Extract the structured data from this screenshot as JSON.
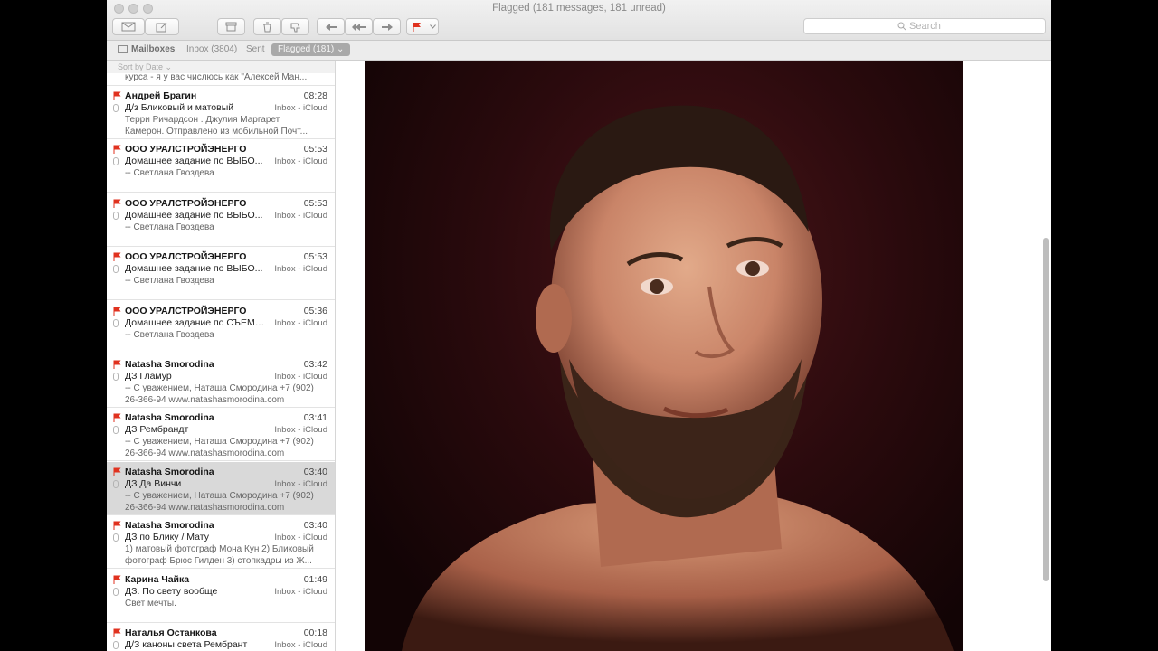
{
  "window": {
    "title": "Flagged (181 messages, 181 unread)"
  },
  "toolbar": {
    "search_placeholder": "Search"
  },
  "favorites": {
    "mailboxes": "Mailboxes",
    "inbox": "Inbox (3804)",
    "sent": "Sent",
    "flagged": "Flagged (181) ⌄"
  },
  "sort": {
    "label": "Sort by Date ⌄"
  },
  "list": {
    "partial_preview": "курса - я у вас числюсь  как \"Алексей Ман...",
    "messages": [
      {
        "sender": "Андрей Брагин",
        "time": "08:28",
        "subject": "Д/з Бликовый и матовый",
        "mailbox": "Inbox - iCloud",
        "preview1": "Терри Ричардсон . Джулия Маргарет",
        "preview2": "Камерон. Отправлено из мобильной Почт..."
      },
      {
        "sender": "ООО УРАЛСТРОЙЭНЕРГО",
        "time": "05:53",
        "subject": "Домашнее задание по ВЫБО...",
        "mailbox": "Inbox - iCloud",
        "preview1": "-- Светлана Гвоздева",
        "preview2": ""
      },
      {
        "sender": "ООО УРАЛСТРОЙЭНЕРГО",
        "time": "05:53",
        "subject": "Домашнее задание по ВЫБО...",
        "mailbox": "Inbox - iCloud",
        "preview1": "-- Светлана Гвоздева",
        "preview2": ""
      },
      {
        "sender": "ООО УРАЛСТРОЙЭНЕРГО",
        "time": "05:53",
        "subject": "Домашнее задание по ВЫБО...",
        "mailbox": "Inbox - iCloud",
        "preview1": "-- Светлана Гвоздева",
        "preview2": ""
      },
      {
        "sender": "ООО УРАЛСТРОЙЭНЕРГО",
        "time": "05:36",
        "subject": "Домашнее задание по СЪЕМКЕ",
        "mailbox": "Inbox - iCloud",
        "preview1": "-- Светлана Гвоздева",
        "preview2": ""
      },
      {
        "sender": "Natasha Smorodina",
        "time": "03:42",
        "subject": "ДЗ Гламур",
        "mailbox": "Inbox - iCloud",
        "preview1": "-- С уважением, Наташа Смородина +7 (902)",
        "preview2": "26-366-94 www.natashasmorodina.com"
      },
      {
        "sender": "Natasha Smorodina",
        "time": "03:41",
        "subject": "ДЗ Рембрандт",
        "mailbox": "Inbox - iCloud",
        "preview1": "-- С уважением, Наташа Смородина +7 (902)",
        "preview2": "26-366-94 www.natashasmorodina.com"
      },
      {
        "sender": "Natasha Smorodina",
        "time": "03:40",
        "subject": "ДЗ Да Винчи",
        "mailbox": "Inbox - iCloud",
        "preview1": "-- С уважением, Наташа Смородина +7 (902)",
        "preview2": "26-366-94 www.natashasmorodina.com"
      },
      {
        "sender": "Natasha Smorodina",
        "time": "03:40",
        "subject": "ДЗ по Блику / Мату",
        "mailbox": "Inbox - iCloud",
        "preview1": "1) матовый фотограф Мона Кун 2) Бликовый",
        "preview2": "фотограф Брюс Гилден 3) стопкадры из Ж..."
      },
      {
        "sender": "Карина Чайка",
        "time": "01:49",
        "subject": "ДЗ. По свету вообще",
        "mailbox": "Inbox - iCloud",
        "preview1": "Свет мечты.",
        "preview2": ""
      },
      {
        "sender": "Наталья Останкова",
        "time": "00:18",
        "subject": "Д/З каноны света Рембрант",
        "mailbox": "Inbox - iCloud",
        "preview1": "",
        "preview2": ""
      }
    ]
  },
  "colors": {
    "flag": "#e0321f",
    "selected_row": "#d9d9d9"
  }
}
